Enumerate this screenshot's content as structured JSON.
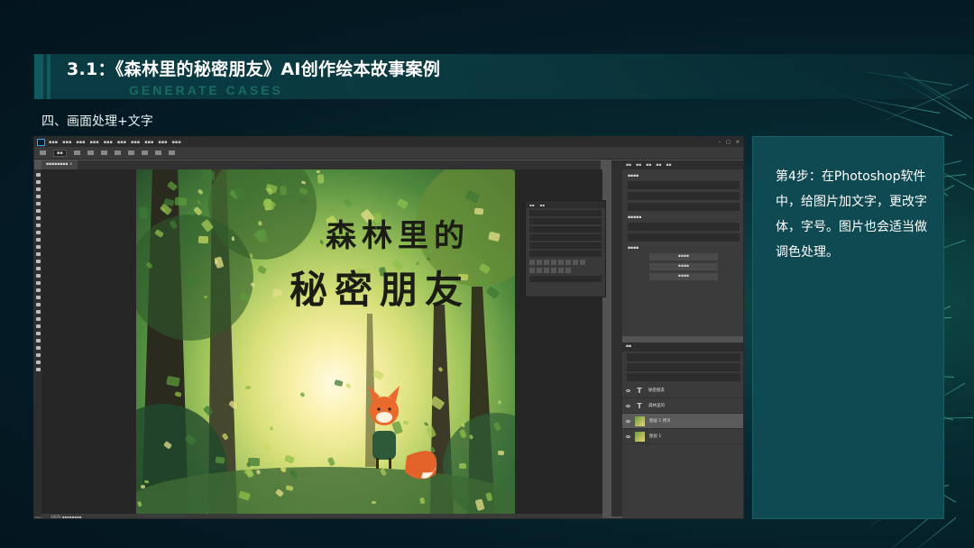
{
  "header": {
    "title": "3.1：《森林里的秘密朋友》AI创作绘本故事案例",
    "subtitle": "GENERATE CASES"
  },
  "section": {
    "heading": "四、画面处理+文字"
  },
  "info": {
    "text": "第4步：在Photoshop软件中，给图片加文字，更改字体，字号。图片也会适当做调色处理。"
  },
  "screenshot": {
    "app": "Photoshop",
    "artwork_title_line1": "森林里的",
    "artwork_title_line2": "秘密朋友",
    "layers": [
      {
        "name": "秘密朋友",
        "kind": "text",
        "selected": false
      },
      {
        "name": "森林里的",
        "kind": "text",
        "selected": false
      },
      {
        "name": "图层 1 拷贝",
        "kind": "image",
        "selected": true
      },
      {
        "name": "图层 1",
        "kind": "image",
        "selected": false
      }
    ]
  },
  "colors": {
    "background": "#041a24",
    "title_bar": "#0b3940",
    "info_box": "#0f4a52",
    "subtitle": "#1a6a66"
  }
}
